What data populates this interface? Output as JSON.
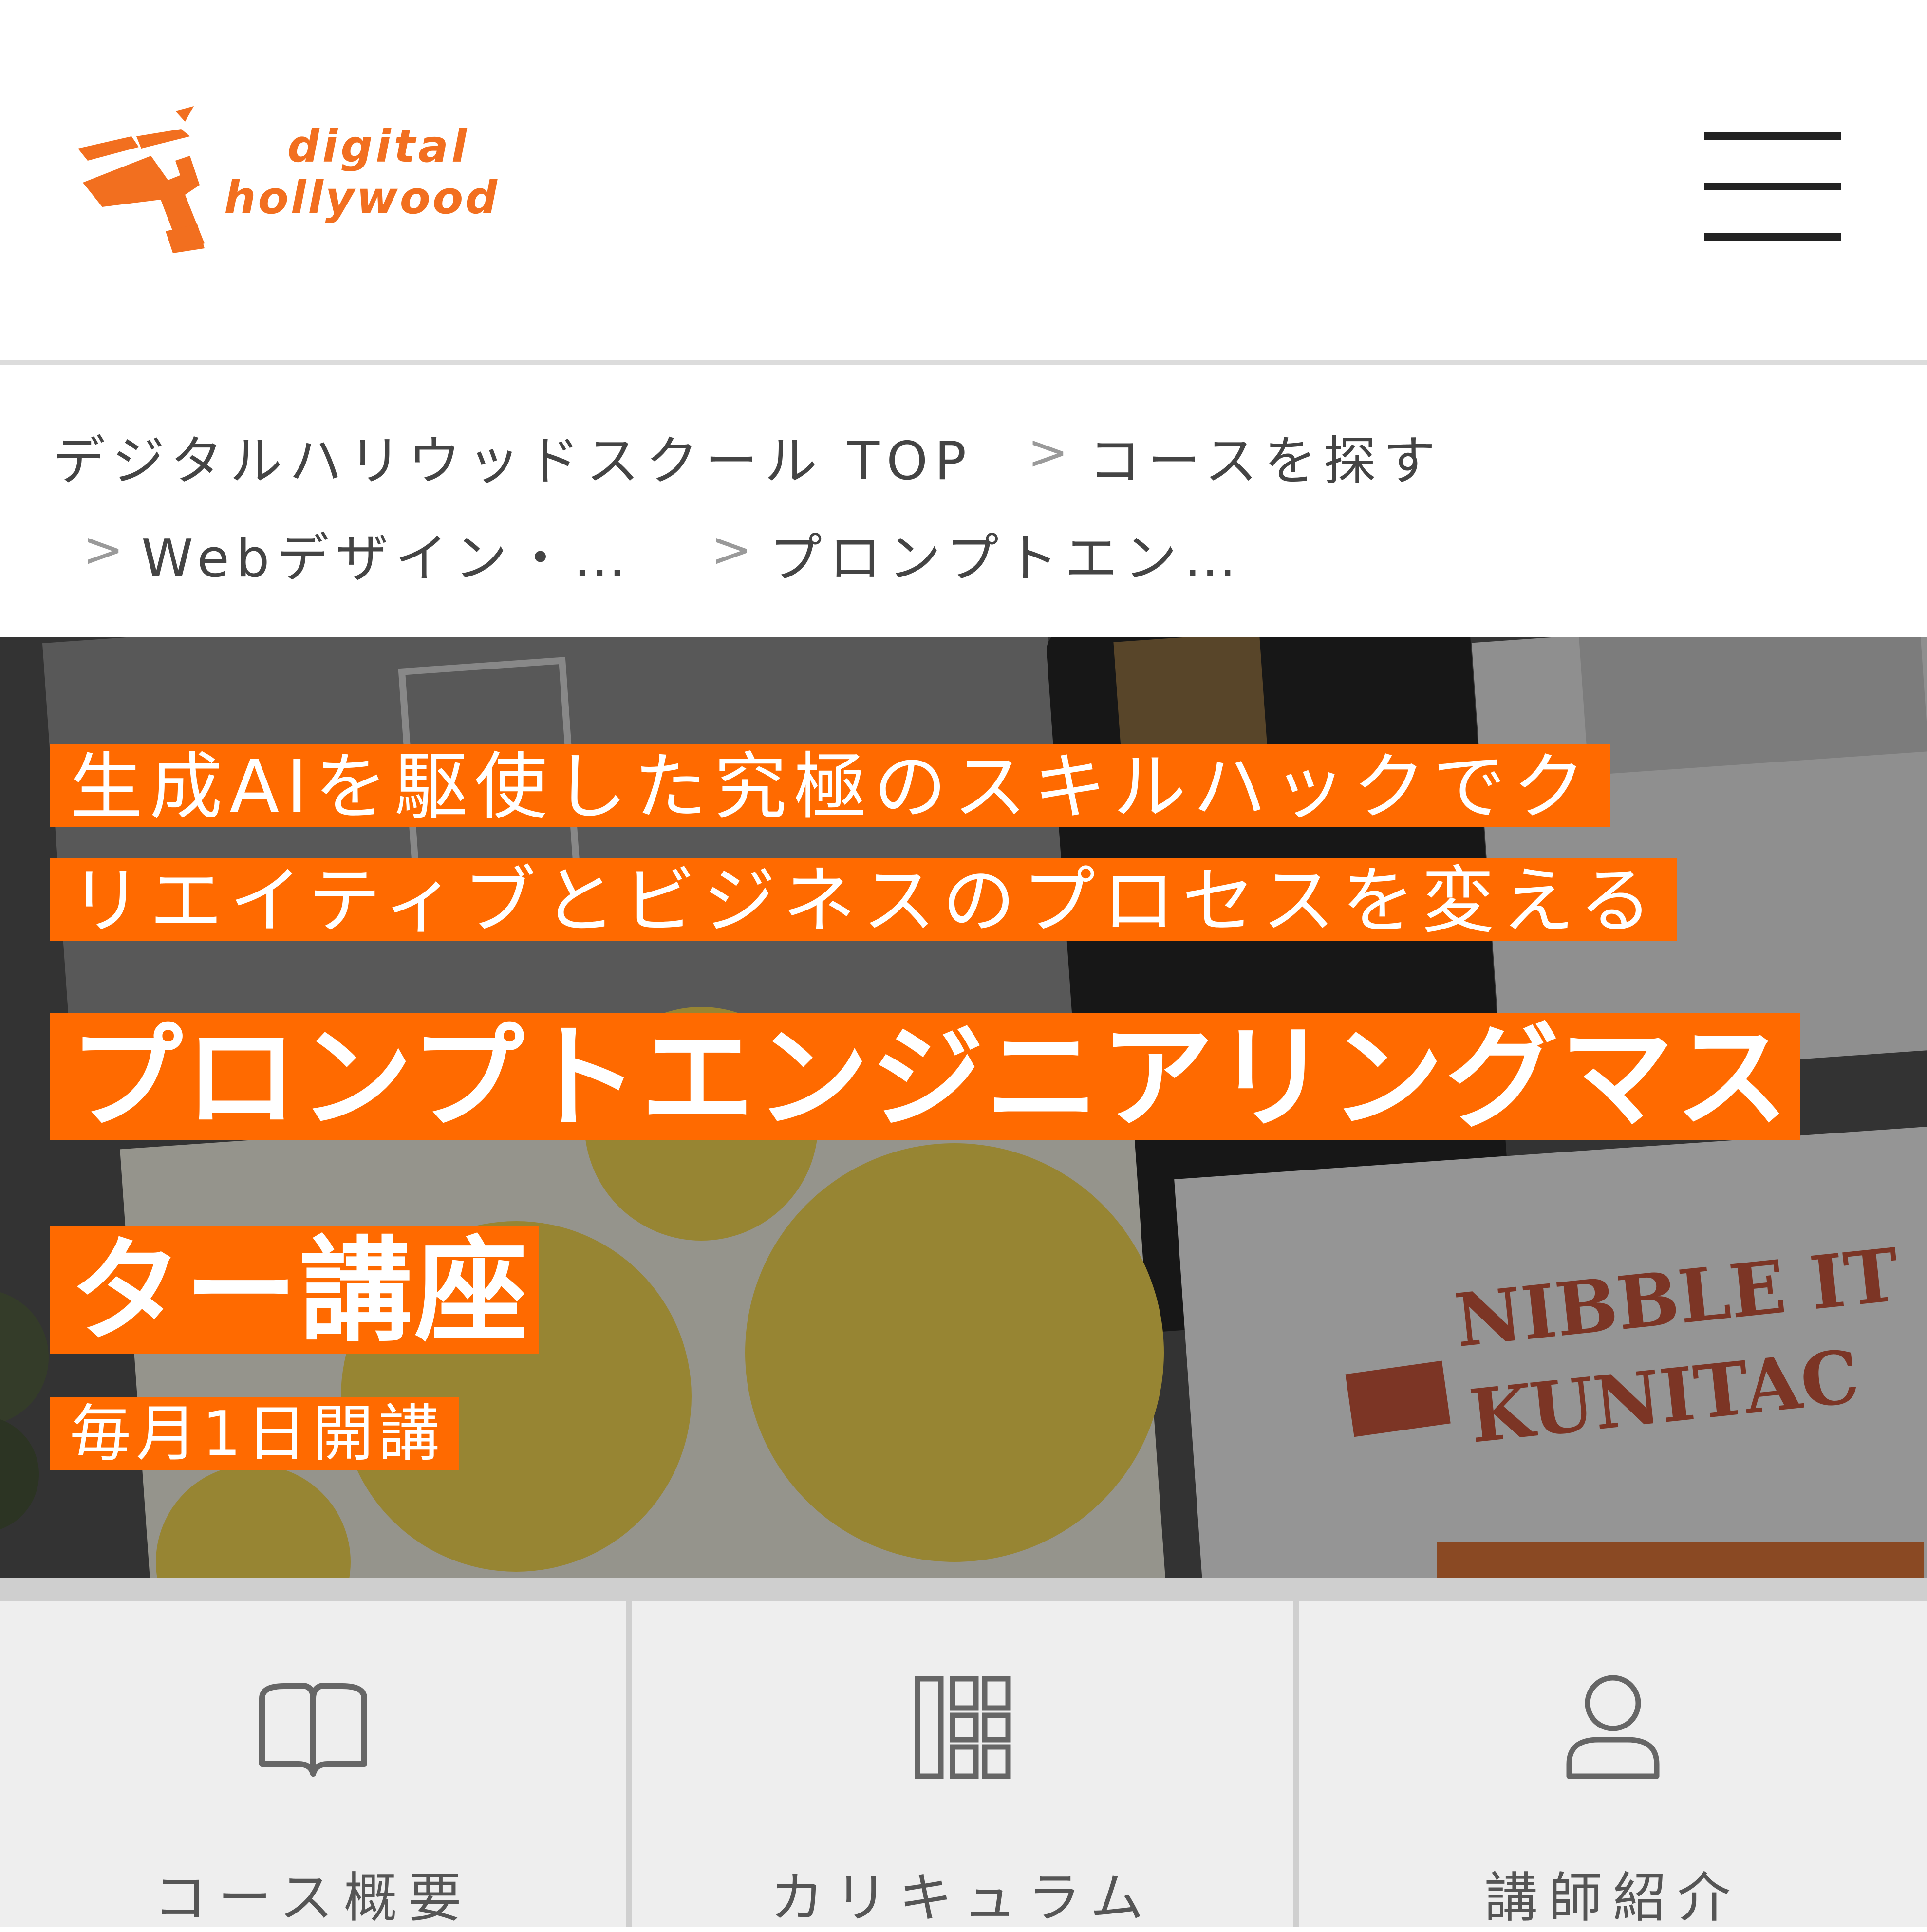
{
  "brand": {
    "logo_text_line1": "digital",
    "logo_text_line2": "hollywood",
    "color": "#f26f1f"
  },
  "header": {
    "menu_icon": "hamburger-icon"
  },
  "breadcrumb": {
    "items": [
      "デジタルハリウッドスクール TOP",
      "コースを探す",
      "Webデザイン・…",
      "プロンプトエン…"
    ],
    "separator": ">"
  },
  "hero": {
    "subtitle_line1": "生成AIを駆使した究極のスキルハックでク",
    "subtitle_line2": "リエイティブとビジネスのプロセスを変える",
    "title_line1": "プロンプトエンジニアリングマス",
    "title_line2": "ター講座",
    "schedule": "毎月1日開講",
    "highlight_color": "#ff6a00"
  },
  "tabs": [
    {
      "label": "コース概要",
      "icon": "open-book-icon"
    },
    {
      "label": "カリキュラム",
      "icon": "grid-icon"
    },
    {
      "label": "講師紹介",
      "icon": "person-icon"
    }
  ]
}
